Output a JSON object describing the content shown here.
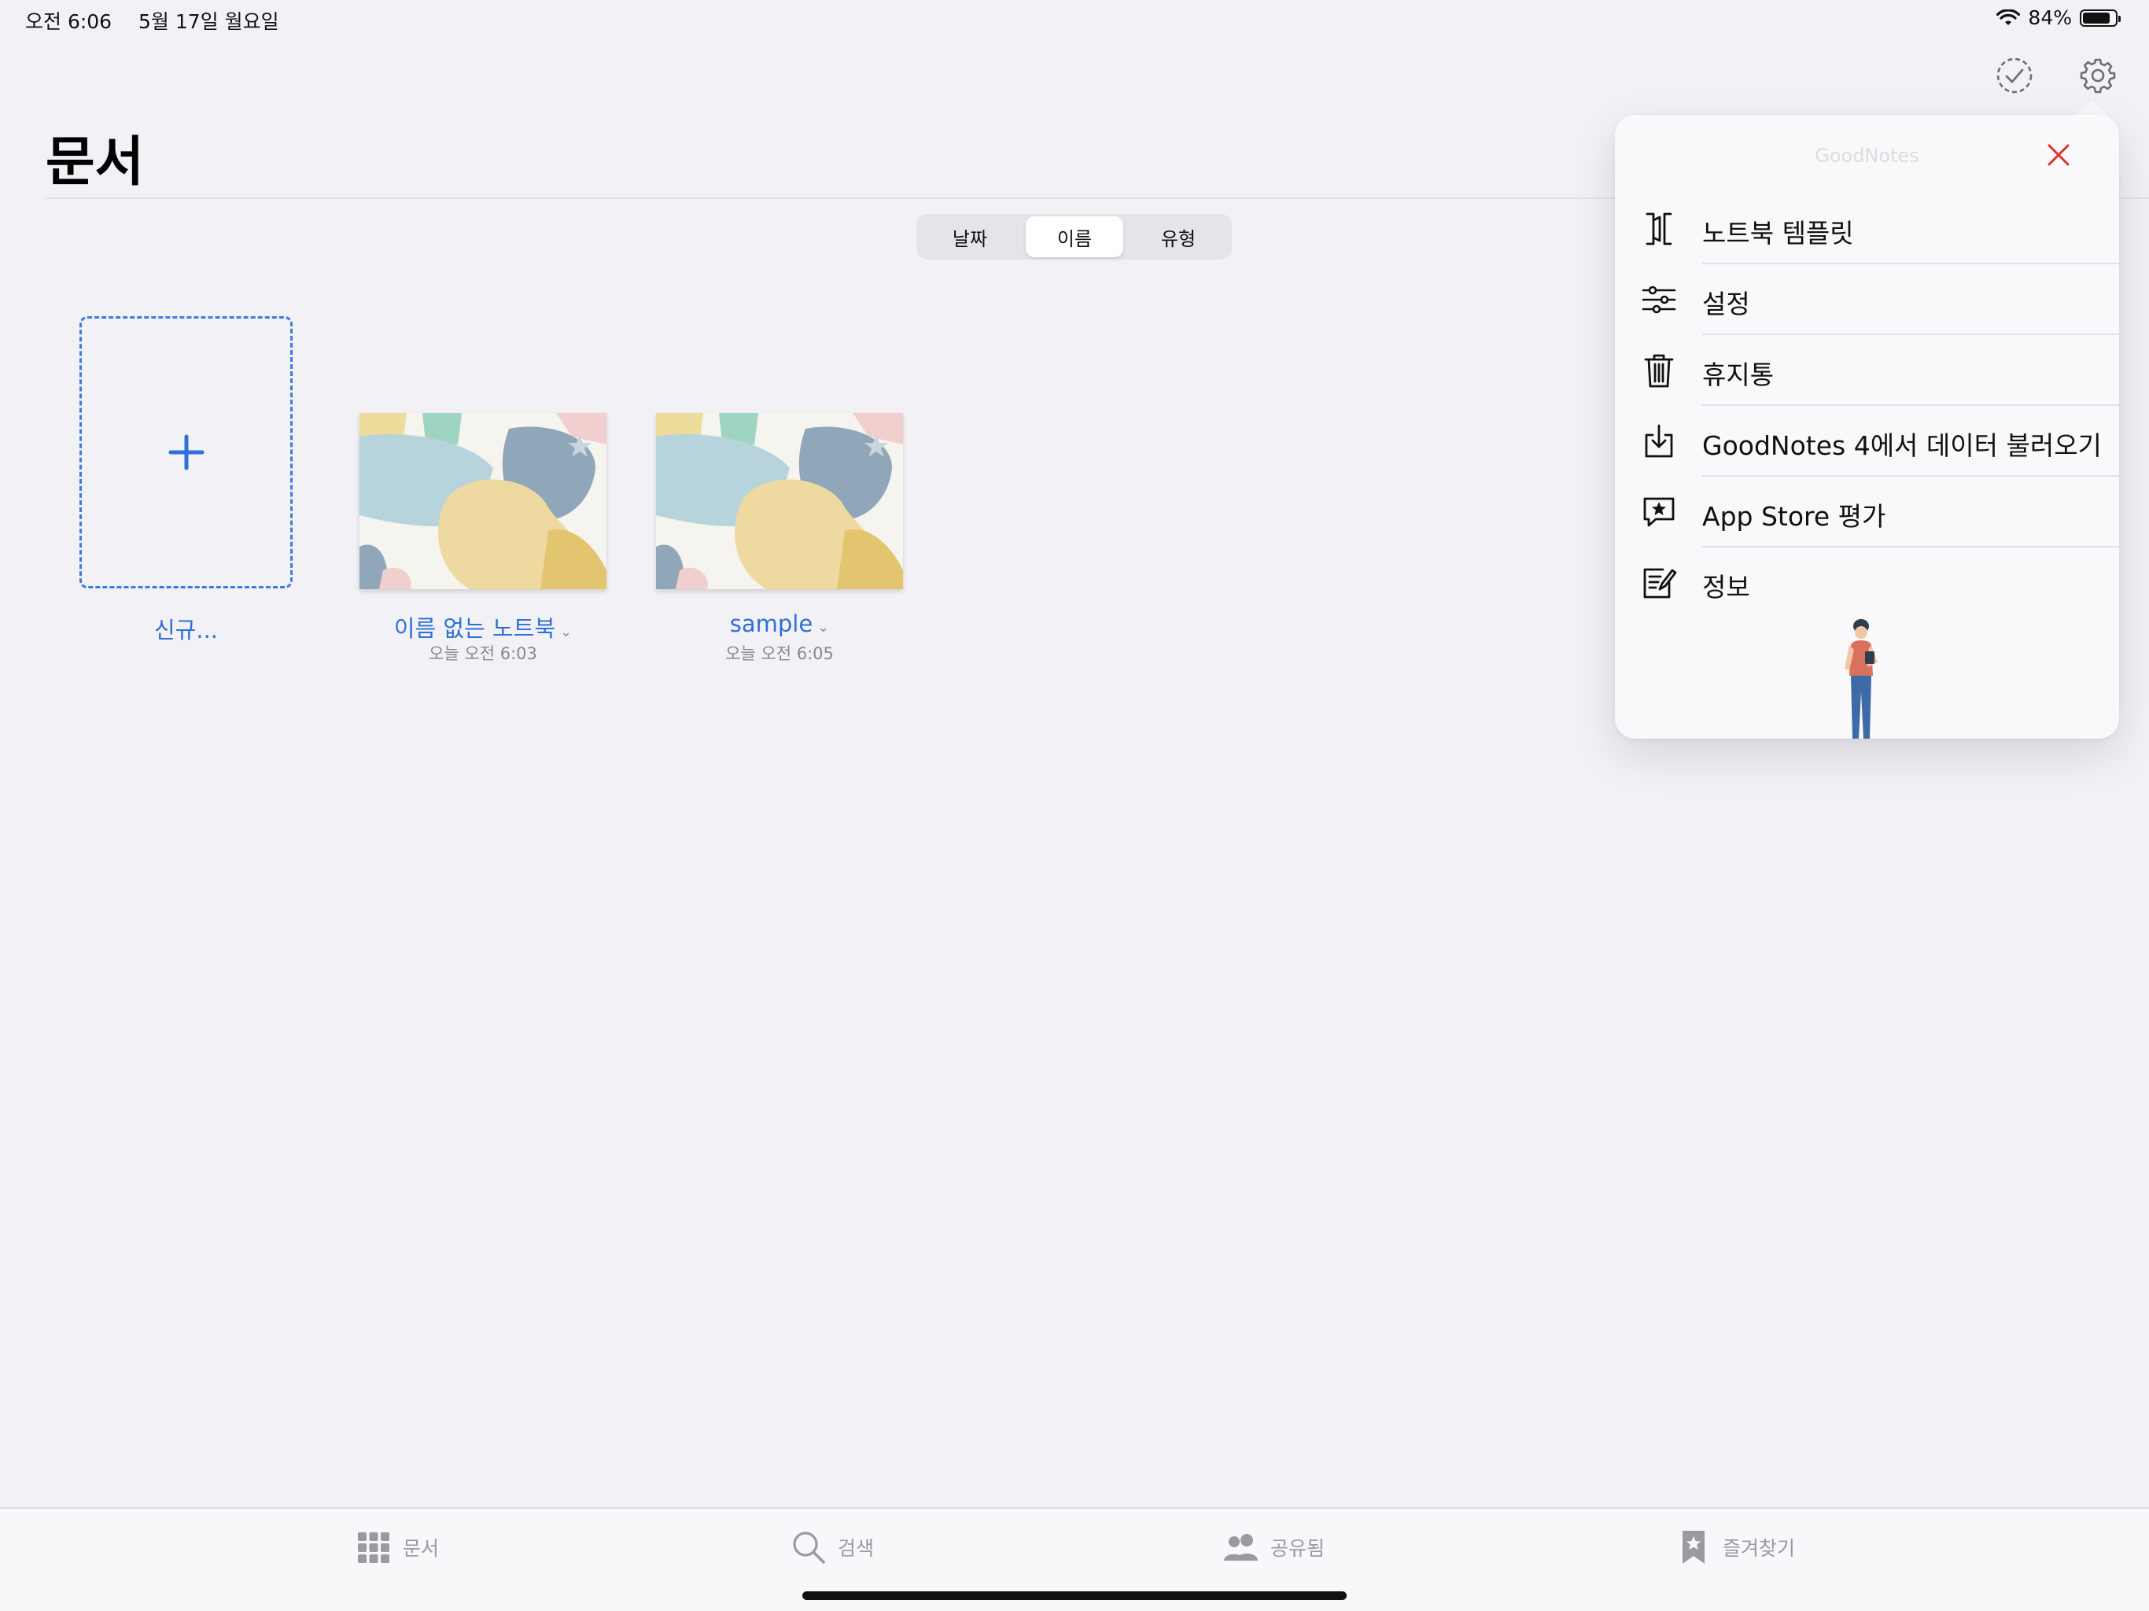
{
  "status_bar": {
    "time": "오전 6:06",
    "date": "5월 17일 월요일",
    "battery_text": "84%",
    "battery_level": 0.84
  },
  "page": {
    "title": "문서"
  },
  "sort_control": {
    "options": [
      "날짜",
      "이름",
      "유형"
    ],
    "selected": "이름"
  },
  "documents": {
    "new_label": "신규...",
    "items": [
      {
        "title": "이름 없는 노트북",
        "date": "오늘 오전 6:03"
      },
      {
        "title": "sample",
        "date": "오늘 오전 6:05"
      }
    ]
  },
  "settings_popover": {
    "title": "GoodNotes",
    "items": [
      {
        "label": "노트북 템플릿",
        "icon": "template-icon"
      },
      {
        "label": "설정",
        "icon": "sliders-icon"
      },
      {
        "label": "휴지통",
        "icon": "trash-icon"
      },
      {
        "label": "GoodNotes 4에서 데이터 불러오기",
        "icon": "import-icon"
      },
      {
        "label": "App Store 평가",
        "icon": "rate-star-bubble-icon"
      },
      {
        "label": "정보",
        "icon": "info-note-icon"
      }
    ]
  },
  "tab_bar": {
    "tabs": [
      {
        "label": "문서",
        "icon": "grid-icon"
      },
      {
        "label": "검색",
        "icon": "search-icon"
      },
      {
        "label": "공유됨",
        "icon": "people-icon"
      },
      {
        "label": "즐겨찾기",
        "icon": "bookmark-star-icon"
      }
    ]
  },
  "colors": {
    "accent": "#2f6fd6",
    "close_red": "#e0302a",
    "background": "#f2f2f6"
  }
}
